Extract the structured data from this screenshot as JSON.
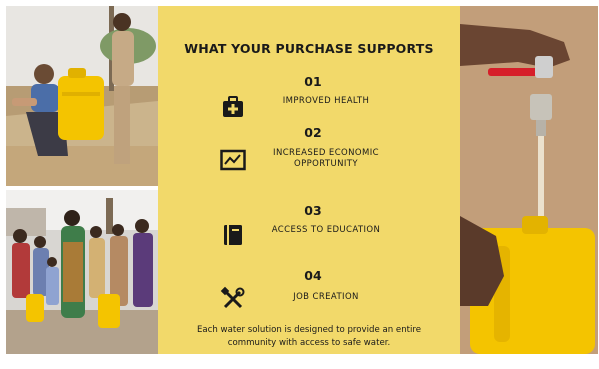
{
  "panel": {
    "heading": "WHAT YOUR PURCHASE SUPPORTS",
    "items": [
      {
        "number": "01",
        "label": "IMPROVED HEALTH",
        "icon": "medical-kit-icon"
      },
      {
        "number": "02",
        "label": "INCREASED ECONOMIC OPPORTUNITY",
        "icon": "chart-line-icon"
      },
      {
        "number": "03",
        "label": "ACCESS TO EDUCATION",
        "icon": "book-icon"
      },
      {
        "number": "04",
        "label": "JOB CREATION",
        "icon": "tools-icon"
      }
    ],
    "footer": "Each water solution is designed to provide an entire community with access to safe water."
  },
  "colors": {
    "panel_bg": "#f2d96a",
    "jerrycan_yellow": "#f4c400"
  },
  "photos": {
    "top_left": "men-with-yellow-jerrycan-photo",
    "bottom_left": "community-group-photo",
    "right": "tap-filling-jerrycan-photo"
  }
}
